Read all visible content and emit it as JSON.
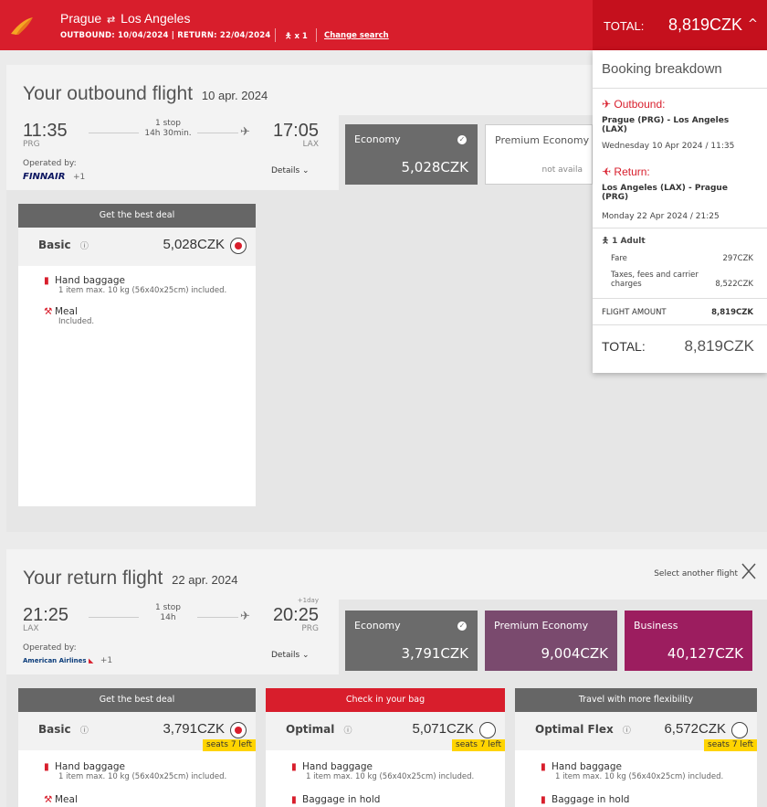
{
  "header": {
    "origin": "Prague",
    "swap_symbol": "⇄",
    "destination": "Los Angeles",
    "outbound_label": "OUTBOUND: 10/04/2024",
    "return_label": "RETURN: 22/04/2024",
    "pax": "x 1",
    "change_search": "Change search",
    "total_label": "TOTAL:",
    "total_amount": "8,819CZK",
    "caret": "^"
  },
  "breakdown": {
    "title": "Booking breakdown",
    "outbound_label": "Outbound:",
    "outbound_route": "Prague (PRG) - Los Angeles (LAX)",
    "outbound_date": "Wednesday 10 Apr 2024 / 11:35",
    "return_label": "Return:",
    "return_route": "Los Angeles (LAX) - Prague (PRG)",
    "return_date": "Monday 22 Apr 2024 / 21:25",
    "adult": "1 Adult",
    "fare_label": "Fare",
    "fare_value": "297CZK",
    "taxes_label": "Taxes, fees and carrier charges",
    "taxes_value": "8,522CZK",
    "flight_amount_label": "FLIGHT AMOUNT",
    "flight_amount_value": "8,819CZK",
    "total_label": "TOTAL:",
    "total_value": "8,819CZK"
  },
  "outbound": {
    "title": "Your outbound flight",
    "date": "10 apr. 2024",
    "dep_time": "11:35",
    "dep_code": "PRG",
    "stops": "1 stop",
    "duration": "14h 30min.",
    "arr_time": "17:05",
    "arr_code": "LAX",
    "operated_by": "Operated by:",
    "airline": "FINNAIR",
    "plus": "+1",
    "details": "Details ⌄",
    "tabs": {
      "economy_name": "Economy",
      "economy_price": "5,028CZK",
      "premium_name": "Premium Economy",
      "premium_price": "not availa"
    },
    "card": {
      "head": "Get the best deal",
      "name": "Basic",
      "info": "ⓘ",
      "price": "5,028CZK",
      "f1_title": "Hand baggage",
      "f1_desc": "1 item max. 10 kg (56x40x25cm) included.",
      "f2_title": "Meal",
      "f2_desc": "Included."
    }
  },
  "return": {
    "title": "Your return flight",
    "date": "22 apr. 2024",
    "select_another": "Select another flight",
    "dep_time": "21:25",
    "dep_code": "LAX",
    "stops": "1 stop",
    "duration": "14h",
    "plus_day": "+1day",
    "arr_time": "20:25",
    "arr_code": "PRG",
    "operated_by": "Operated by:",
    "airline": "American Airlines",
    "plus": "+1",
    "details": "Details ⌄",
    "tabs": {
      "economy_name": "Economy",
      "economy_price": "3,791CZK",
      "premium_name": "Premium Economy",
      "premium_price": "9,004CZK",
      "business_name": "Business",
      "business_price": "40,127CZK"
    },
    "cards": [
      {
        "head": "Get the best deal",
        "name": "Basic",
        "info": "ⓘ",
        "price": "3,791CZK",
        "seats": "seats 7 left",
        "f1_title": "Hand baggage",
        "f1_desc": "1 item max. 10 kg (56x40x25cm) included.",
        "f2_title": "Meal"
      },
      {
        "head": "Check in your bag",
        "name": "Optimal",
        "info": "ⓘ",
        "price": "5,071CZK",
        "seats": "seats 7 left",
        "f1_title": "Hand baggage",
        "f1_desc": "1 item max. 10 kg (56x40x25cm) included.",
        "f2_title": "Baggage in hold"
      },
      {
        "head": "Travel with more flexibility",
        "name": "Optimal Flex",
        "info": "ⓘ",
        "price": "6,572CZK",
        "seats": "seats 7 left",
        "f1_title": "Hand baggage",
        "f1_desc": "1 item max. 10 kg (56x40x25cm) included.",
        "f2_title": "Baggage in hold"
      }
    ]
  },
  "colors": {
    "brand_red": "#d81e2c",
    "economy_gray": "#6b6b6b",
    "premium_purple": "#7a4a6e",
    "business_magenta": "#9c1d5f",
    "seats_yellow": "#ffd400"
  }
}
